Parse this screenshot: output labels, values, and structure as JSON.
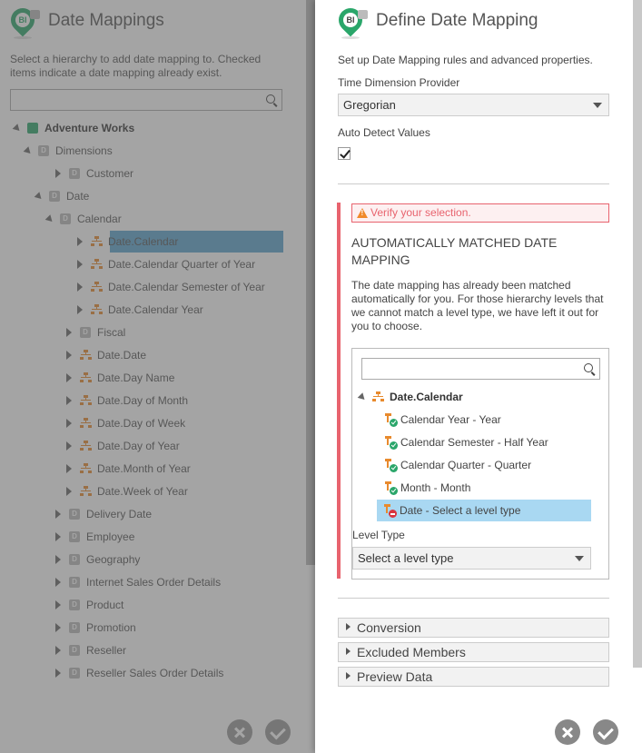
{
  "left": {
    "title": "Date Mappings",
    "description": "Select a hierarchy to add date mapping to. Checked items indicate a date mapping already exist.",
    "search_placeholder": "",
    "tree": [
      {
        "label": "Adventure Works",
        "icon": "cube-icon",
        "expander": "expanded",
        "indent": 0,
        "bold": true
      },
      {
        "label": "Dimensions",
        "icon": "dimension-folder-icon",
        "expander": "expanded",
        "indent": 1
      },
      {
        "label": "Customer",
        "icon": "dimension-folder-icon",
        "expander": "collapsed",
        "indent": 2
      },
      {
        "label": "Date",
        "icon": "dimension-folder-icon",
        "expander": "expanded",
        "indent": 2
      },
      {
        "label": "Calendar",
        "icon": "dimension-folder-icon",
        "expander": "expanded",
        "indent": 3
      },
      {
        "label": "Date.Calendar",
        "icon": "hierarchy-icon",
        "expander": "collapsed",
        "indent": 4,
        "selected": true
      },
      {
        "label": "Date.Calendar Quarter of Year",
        "icon": "hierarchy-icon",
        "expander": "collapsed",
        "indent": 4
      },
      {
        "label": "Date.Calendar Semester of Year",
        "icon": "hierarchy-icon",
        "expander": "collapsed",
        "indent": 4
      },
      {
        "label": "Date.Calendar Year",
        "icon": "hierarchy-icon",
        "expander": "collapsed",
        "indent": 4
      },
      {
        "label": "Fiscal",
        "icon": "dimension-folder-icon",
        "expander": "collapsed",
        "indent": 3
      },
      {
        "label": "Date.Date",
        "icon": "hierarchy-icon",
        "expander": "collapsed",
        "indent": 3
      },
      {
        "label": "Date.Day Name",
        "icon": "hierarchy-icon",
        "expander": "collapsed",
        "indent": 3
      },
      {
        "label": "Date.Day of Month",
        "icon": "hierarchy-icon",
        "expander": "collapsed",
        "indent": 3
      },
      {
        "label": "Date.Day of Week",
        "icon": "hierarchy-icon",
        "expander": "collapsed",
        "indent": 3
      },
      {
        "label": "Date.Day of Year",
        "icon": "hierarchy-icon",
        "expander": "collapsed",
        "indent": 3
      },
      {
        "label": "Date.Month of Year",
        "icon": "hierarchy-icon",
        "expander": "collapsed",
        "indent": 3
      },
      {
        "label": "Date.Week of Year",
        "icon": "hierarchy-icon",
        "expander": "collapsed",
        "indent": 3
      },
      {
        "label": "Delivery Date",
        "icon": "dimension-folder-icon",
        "expander": "collapsed",
        "indent": 2
      },
      {
        "label": "Employee",
        "icon": "dimension-folder-icon",
        "expander": "collapsed",
        "indent": 2
      },
      {
        "label": "Geography",
        "icon": "dimension-folder-icon",
        "expander": "collapsed",
        "indent": 2
      },
      {
        "label": "Internet Sales Order Details",
        "icon": "dimension-folder-icon",
        "expander": "collapsed",
        "indent": 2
      },
      {
        "label": "Product",
        "icon": "dimension-folder-icon",
        "expander": "collapsed",
        "indent": 2
      },
      {
        "label": "Promotion",
        "icon": "dimension-folder-icon",
        "expander": "collapsed",
        "indent": 2
      },
      {
        "label": "Reseller",
        "icon": "dimension-folder-icon",
        "expander": "collapsed",
        "indent": 2
      },
      {
        "label": "Reseller Sales Order Details",
        "icon": "dimension-folder-icon",
        "expander": "collapsed",
        "indent": 2
      }
    ]
  },
  "right": {
    "title": "Define Date Mapping",
    "description": "Set up Date Mapping rules and advanced properties.",
    "provider_label": "Time Dimension Provider",
    "provider_value": "Gregorian",
    "auto_detect_label": "Auto Detect Values",
    "auto_detect_checked": true,
    "warning": "Verify your selection.",
    "section_title": "AUTOMATICALLY MATCHED DATE MAPPING",
    "section_description": "The date mapping has already been matched automatically for you. For those hierarchy levels that we cannot match a level type, we have left it out for you to choose.",
    "hierarchy": "Date.Calendar",
    "levels": [
      {
        "label": "Calendar Year - Year",
        "status": "matched"
      },
      {
        "label": "Calendar Semester - Half Year",
        "status": "matched"
      },
      {
        "label": "Calendar Quarter - Quarter",
        "status": "matched"
      },
      {
        "label": "Month - Month",
        "status": "matched"
      },
      {
        "label": "Date - Select a level type",
        "status": "unmatched",
        "selected": true
      }
    ],
    "level_type_label": "Level Type",
    "level_type_value": "Select a level type",
    "accordions": [
      "Conversion",
      "Excluded Members",
      "Preview Data"
    ]
  },
  "icons": {
    "logo": "bi-pin-logo-icon",
    "search": "search-icon",
    "cancel": "close-icon",
    "confirm": "check-icon"
  },
  "colors": {
    "accent_green": "#2aa66a",
    "selection_blue": "#5ba4cf",
    "warning_red": "#e8636e",
    "hierarchy_orange": "#e88a2d"
  }
}
